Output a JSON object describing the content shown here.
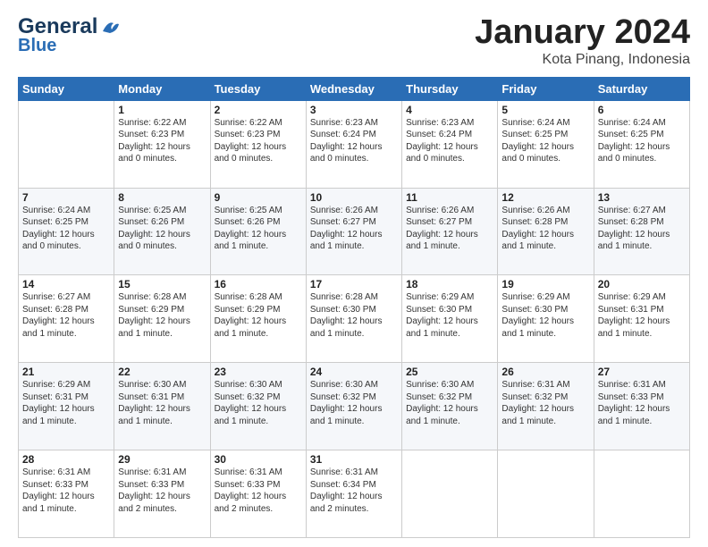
{
  "header": {
    "logo_general": "General",
    "logo_blue": "Blue",
    "title": "January 2024",
    "subtitle": "Kota Pinang, Indonesia"
  },
  "columns": [
    "Sunday",
    "Monday",
    "Tuesday",
    "Wednesday",
    "Thursday",
    "Friday",
    "Saturday"
  ],
  "weeks": [
    [
      {
        "day": "",
        "info": ""
      },
      {
        "day": "1",
        "info": "Sunrise: 6:22 AM\nSunset: 6:23 PM\nDaylight: 12 hours\nand 0 minutes."
      },
      {
        "day": "2",
        "info": "Sunrise: 6:22 AM\nSunset: 6:23 PM\nDaylight: 12 hours\nand 0 minutes."
      },
      {
        "day": "3",
        "info": "Sunrise: 6:23 AM\nSunset: 6:24 PM\nDaylight: 12 hours\nand 0 minutes."
      },
      {
        "day": "4",
        "info": "Sunrise: 6:23 AM\nSunset: 6:24 PM\nDaylight: 12 hours\nand 0 minutes."
      },
      {
        "day": "5",
        "info": "Sunrise: 6:24 AM\nSunset: 6:25 PM\nDaylight: 12 hours\nand 0 minutes."
      },
      {
        "day": "6",
        "info": "Sunrise: 6:24 AM\nSunset: 6:25 PM\nDaylight: 12 hours\nand 0 minutes."
      }
    ],
    [
      {
        "day": "7",
        "info": "Sunrise: 6:24 AM\nSunset: 6:25 PM\nDaylight: 12 hours\nand 0 minutes."
      },
      {
        "day": "8",
        "info": "Sunrise: 6:25 AM\nSunset: 6:26 PM\nDaylight: 12 hours\nand 0 minutes."
      },
      {
        "day": "9",
        "info": "Sunrise: 6:25 AM\nSunset: 6:26 PM\nDaylight: 12 hours\nand 1 minute."
      },
      {
        "day": "10",
        "info": "Sunrise: 6:26 AM\nSunset: 6:27 PM\nDaylight: 12 hours\nand 1 minute."
      },
      {
        "day": "11",
        "info": "Sunrise: 6:26 AM\nSunset: 6:27 PM\nDaylight: 12 hours\nand 1 minute."
      },
      {
        "day": "12",
        "info": "Sunrise: 6:26 AM\nSunset: 6:28 PM\nDaylight: 12 hours\nand 1 minute."
      },
      {
        "day": "13",
        "info": "Sunrise: 6:27 AM\nSunset: 6:28 PM\nDaylight: 12 hours\nand 1 minute."
      }
    ],
    [
      {
        "day": "14",
        "info": "Sunrise: 6:27 AM\nSunset: 6:28 PM\nDaylight: 12 hours\nand 1 minute."
      },
      {
        "day": "15",
        "info": "Sunrise: 6:28 AM\nSunset: 6:29 PM\nDaylight: 12 hours\nand 1 minute."
      },
      {
        "day": "16",
        "info": "Sunrise: 6:28 AM\nSunset: 6:29 PM\nDaylight: 12 hours\nand 1 minute."
      },
      {
        "day": "17",
        "info": "Sunrise: 6:28 AM\nSunset: 6:30 PM\nDaylight: 12 hours\nand 1 minute."
      },
      {
        "day": "18",
        "info": "Sunrise: 6:29 AM\nSunset: 6:30 PM\nDaylight: 12 hours\nand 1 minute."
      },
      {
        "day": "19",
        "info": "Sunrise: 6:29 AM\nSunset: 6:30 PM\nDaylight: 12 hours\nand 1 minute."
      },
      {
        "day": "20",
        "info": "Sunrise: 6:29 AM\nSunset: 6:31 PM\nDaylight: 12 hours\nand 1 minute."
      }
    ],
    [
      {
        "day": "21",
        "info": "Sunrise: 6:29 AM\nSunset: 6:31 PM\nDaylight: 12 hours\nand 1 minute."
      },
      {
        "day": "22",
        "info": "Sunrise: 6:30 AM\nSunset: 6:31 PM\nDaylight: 12 hours\nand 1 minute."
      },
      {
        "day": "23",
        "info": "Sunrise: 6:30 AM\nSunset: 6:32 PM\nDaylight: 12 hours\nand 1 minute."
      },
      {
        "day": "24",
        "info": "Sunrise: 6:30 AM\nSunset: 6:32 PM\nDaylight: 12 hours\nand 1 minute."
      },
      {
        "day": "25",
        "info": "Sunrise: 6:30 AM\nSunset: 6:32 PM\nDaylight: 12 hours\nand 1 minute."
      },
      {
        "day": "26",
        "info": "Sunrise: 6:31 AM\nSunset: 6:32 PM\nDaylight: 12 hours\nand 1 minute."
      },
      {
        "day": "27",
        "info": "Sunrise: 6:31 AM\nSunset: 6:33 PM\nDaylight: 12 hours\nand 1 minute."
      }
    ],
    [
      {
        "day": "28",
        "info": "Sunrise: 6:31 AM\nSunset: 6:33 PM\nDaylight: 12 hours\nand 1 minute."
      },
      {
        "day": "29",
        "info": "Sunrise: 6:31 AM\nSunset: 6:33 PM\nDaylight: 12 hours\nand 2 minutes."
      },
      {
        "day": "30",
        "info": "Sunrise: 6:31 AM\nSunset: 6:33 PM\nDaylight: 12 hours\nand 2 minutes."
      },
      {
        "day": "31",
        "info": "Sunrise: 6:31 AM\nSunset: 6:34 PM\nDaylight: 12 hours\nand 2 minutes."
      },
      {
        "day": "",
        "info": ""
      },
      {
        "day": "",
        "info": ""
      },
      {
        "day": "",
        "info": ""
      }
    ]
  ]
}
